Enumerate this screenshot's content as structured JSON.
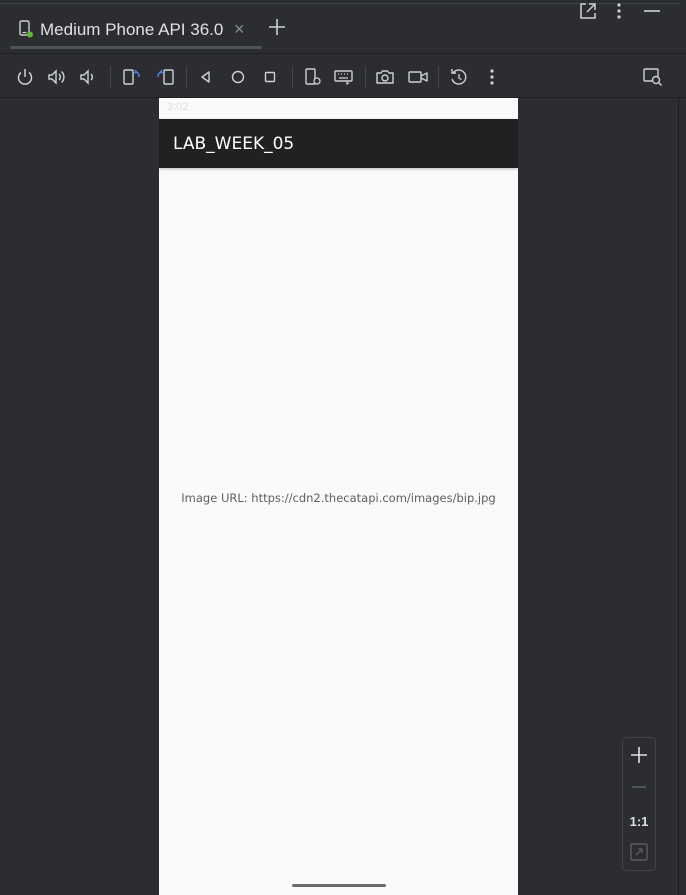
{
  "tab": {
    "title": "Medium Phone API 36.0",
    "close_glyph": "×"
  },
  "toolbar": {
    "icons": [
      "power-icon",
      "volume-up-icon",
      "volume-down-icon",
      "rotate-left-icon",
      "rotate-right-icon",
      "back-icon",
      "home-icon",
      "overview-icon",
      "device-settings-icon",
      "keyboard-icon",
      "screenshot-icon",
      "screen-record-icon",
      "snapshot-icon",
      "more-icon",
      "layout-inspector-icon"
    ]
  },
  "phone": {
    "status_time": "3:02",
    "app_title": "LAB_WEEK_05",
    "content_text": "Image URL: https://cdn2.thecatapi.com/images/bip.jpg"
  },
  "zoom": {
    "actual_size_label": "1:1"
  },
  "colors": {
    "ide_bg": "#2b2d30",
    "appbar": "#212121",
    "screen_bg": "#fafafa",
    "device_dot": "#5fb832"
  }
}
